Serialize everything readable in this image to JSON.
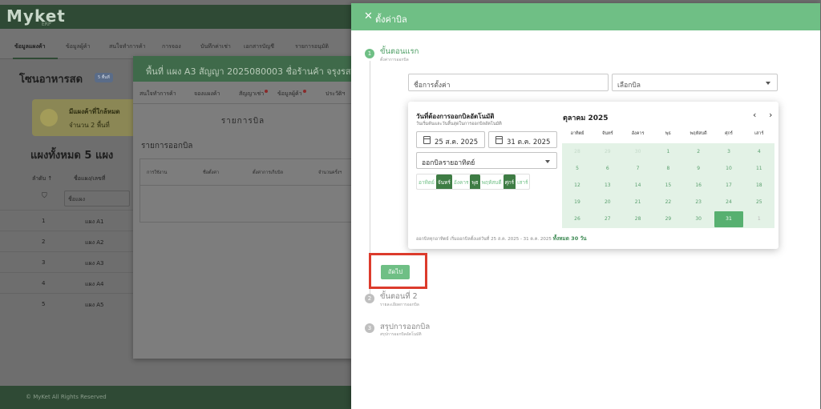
{
  "background": {
    "logo": "Myket",
    "logo_sub": "ERP",
    "nav": [
      "ข้อมูลแผงค้า",
      "ข้อมูลผู้ค้า",
      "สนใจทำการค้า",
      "การจอง",
      "บันทึกค่าเช่า",
      "เอกสารบัญชี",
      "รายการอนุมัติ"
    ],
    "page_title": "โซนอาหารสด",
    "page_badge": "5 พื้นที่",
    "alert_title": "มีแผงค้าที่ใกล้หมด",
    "alert_count": "จำนวน 2 พื้นที่",
    "subtitle": "แผงทั้งหมด 5 แผง",
    "col_order": "ลำดับ ↑",
    "col_name": "ชื่อแผง/เลขที่",
    "filter_placeholder": "ชื่อแผง",
    "rows": [
      {
        "no": "1",
        "name": "แผง A1"
      },
      {
        "no": "2",
        "name": "แผง A2"
      },
      {
        "no": "3",
        "name": "แผง A3"
      },
      {
        "no": "4",
        "name": "แผง A4"
      },
      {
        "no": "5",
        "name": "แผง A5"
      }
    ],
    "footer": "© MyKet All Rights Reserved"
  },
  "modal": {
    "title": "พื้นที่ แผง A3 สัญญา 2025080003 ชื่อร้านค้า จรุงรส",
    "tabs": [
      "สนใจทำการค้า",
      "จองแผงค้า",
      "สัญญาเช่า",
      "ข้อมูลผู้ค้า",
      "ประวัติฯ"
    ],
    "center_title": "รายการบิล",
    "list_title": "รายการออกบิล",
    "table_headers": [
      "การใช้งาน",
      "ชื่อตั้งค่า",
      "ตั้งค่าการเก็บบิล",
      "จำนวนครั้งฯ"
    ]
  },
  "drawer": {
    "title": "ตั้งค่าบิล",
    "steps": [
      {
        "num": "1",
        "title": "ขั้นตอนแรก",
        "sub": "ตั้งค่าการออกบิล"
      },
      {
        "num": "2",
        "title": "ขั้นตอนที่ 2",
        "sub": "รายละเอียดการออกบิล"
      },
      {
        "num": "3",
        "title": "สรุปการออกบิล",
        "sub": "สรุปการออกบิลอัตโนมัติ"
      }
    ],
    "name_placeholder": "ชื่อการตั้งค่า",
    "bill_select": "เลือกบิล",
    "next_button": "ถัดไป"
  },
  "popup": {
    "title": "วันที่ต้องการออกบิลอัตโนมัติ",
    "sub": "วันเริ่มต้นและวันสิ้นสุดในการออกบิลอัตโนมัติ",
    "start_date": "25 ส.ค. 2025",
    "end_date": "31 ต.ค. 2025",
    "frequency": "ออกบิลรายอาทิตย์",
    "days": [
      {
        "label": "อาทิตย์",
        "on": false
      },
      {
        "label": "จันทร์",
        "on": true
      },
      {
        "label": "อังคาร",
        "on": false
      },
      {
        "label": "พุธ",
        "on": true
      },
      {
        "label": "พฤหัสบดี",
        "on": false
      },
      {
        "label": "ศุกร์",
        "on": true
      },
      {
        "label": "เสาร์",
        "on": false
      }
    ],
    "footer_text": "ออกบิลทุกอาทิตย์ เริ่มออกบิลตั้งแต่วันที่ 25 ส.ค. 2025 - 31 ต.ค. 2025",
    "footer_total": "ทั้งหมด 30 วัน",
    "calendar": {
      "month": "ตุลาคม 2025",
      "prev": "‹",
      "next": "›",
      "weekdays": [
        "อาทิตย์",
        "จันทร์",
        "อังคาร",
        "พุธ",
        "พฤหัสบดี",
        "ศุกร์",
        "เสาร์"
      ],
      "weeks": [
        [
          "28",
          "29",
          "30",
          "1",
          "2",
          "3",
          "4"
        ],
        [
          "5",
          "6",
          "7",
          "8",
          "9",
          "10",
          "11"
        ],
        [
          "12",
          "13",
          "14",
          "15",
          "16",
          "17",
          "18"
        ],
        [
          "19",
          "20",
          "21",
          "22",
          "23",
          "24",
          "25"
        ],
        [
          "26",
          "27",
          "28",
          "29",
          "30",
          "31",
          "1"
        ]
      ],
      "selected": "31"
    }
  }
}
